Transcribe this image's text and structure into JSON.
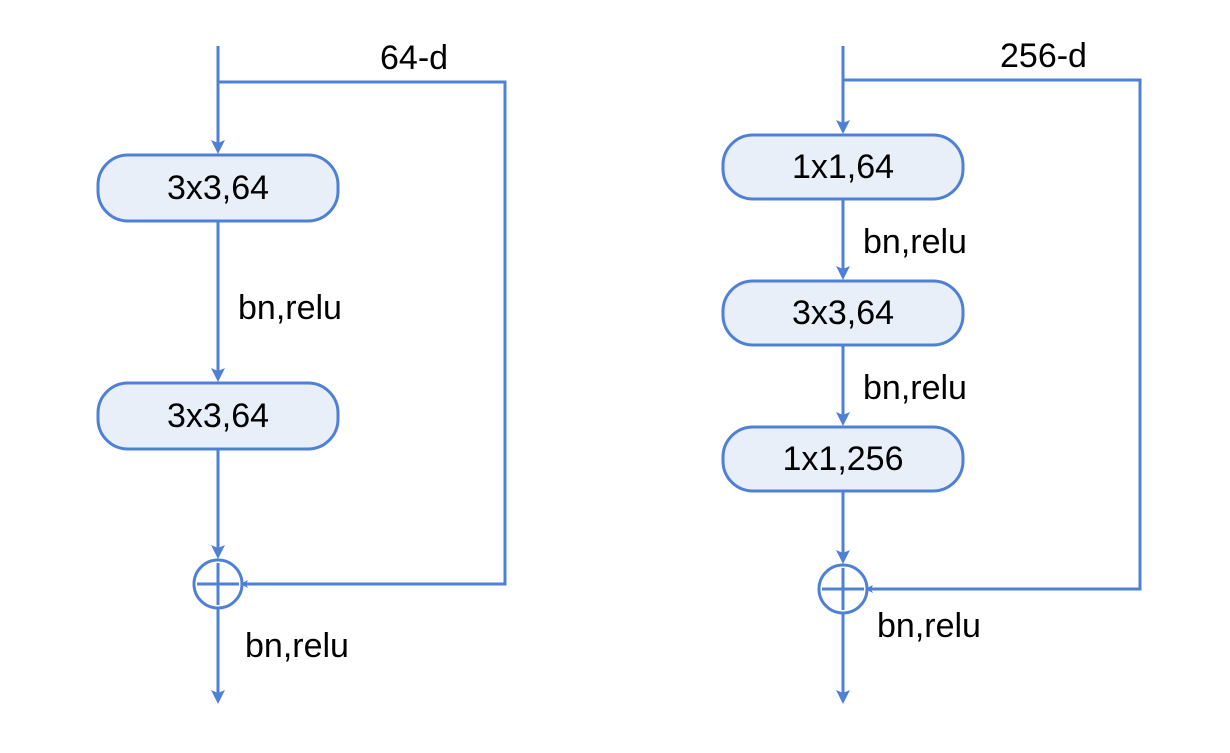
{
  "left": {
    "top_label": "64-d",
    "block1": "3x3,64",
    "edge1_label": "bn,relu",
    "block2": "3x3,64",
    "final_label": "bn,relu"
  },
  "right": {
    "top_label": "256-d",
    "block1": "1x1,64",
    "edge1_label": "bn,relu",
    "block2": "3x3,64",
    "edge2_label": "bn,relu",
    "block3": "1x1,256",
    "final_label": "bn,relu"
  },
  "colors": {
    "stroke": "#4e80d6",
    "fill": "#e8eff9"
  }
}
